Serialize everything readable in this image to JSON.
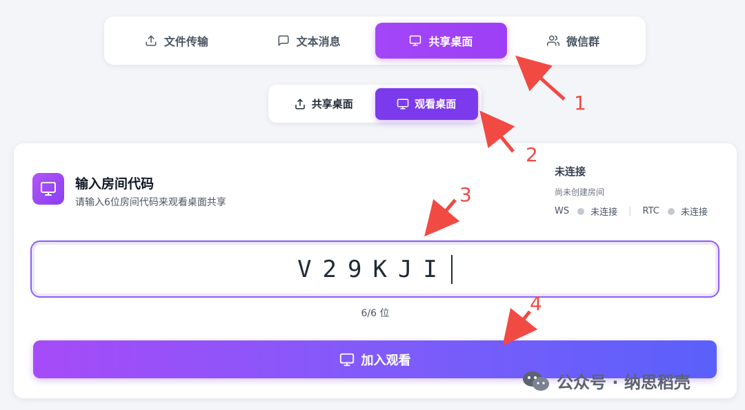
{
  "main_tabs": [
    {
      "label": "文件传输",
      "icon": "upload-icon",
      "active": false
    },
    {
      "label": "文本消息",
      "icon": "message-icon",
      "active": false
    },
    {
      "label": "共享桌面",
      "icon": "monitor-icon",
      "active": true
    },
    {
      "label": "微信群",
      "icon": "users-icon",
      "active": false
    }
  ],
  "sub_tabs": [
    {
      "label": "共享桌面",
      "icon": "upload-icon",
      "active": false
    },
    {
      "label": "观看桌面",
      "icon": "monitor-icon",
      "active": true
    }
  ],
  "card": {
    "title": "输入房间代码",
    "subtitle": "请输入6位房间代码来观看桌面共享",
    "icon": "monitor-icon"
  },
  "status": {
    "title": "未连接",
    "subtitle": "尚未创建房间",
    "ws_label": "WS",
    "ws_state": "未连接",
    "rtc_label": "RTC",
    "rtc_state": "未连接",
    "separator": "|"
  },
  "code_input": {
    "value": "V29KJI",
    "counter": "6/6 位"
  },
  "join_button": {
    "label": "加入观看",
    "icon": "monitor-icon"
  },
  "annotations": [
    "1",
    "2",
    "3",
    "4"
  ],
  "watermark": "公众号 · 纳思稻壳",
  "colors": {
    "accent": "#9d3ff6",
    "accent_dark": "#7c3aed",
    "annotation": "#f04a43"
  }
}
